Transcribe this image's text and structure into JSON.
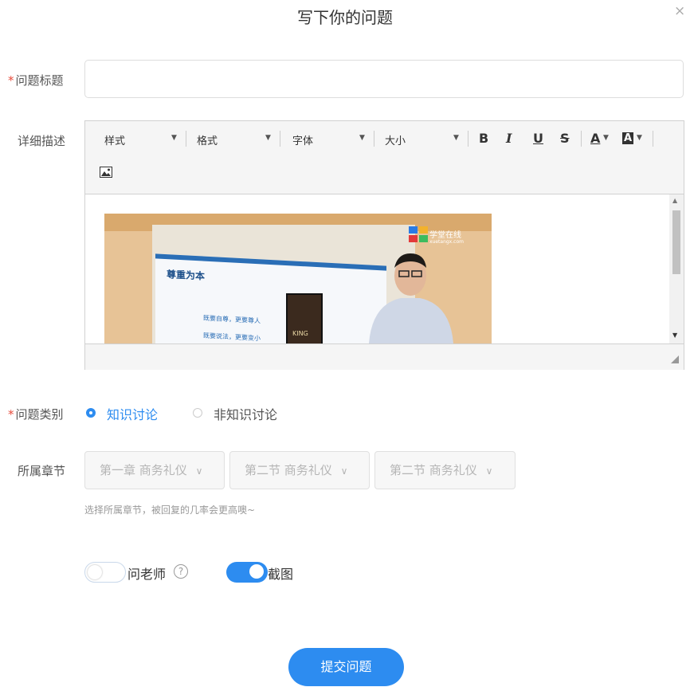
{
  "dialog": {
    "title": "写下你的问题",
    "close_symbol": "×"
  },
  "question_title": {
    "label": "问题标题",
    "required_mark": "*",
    "value": ""
  },
  "description": {
    "label": "详细描述",
    "toolbar": {
      "style_label": "样式",
      "format_label": "格式",
      "font_label": "字体",
      "size_label": "大小",
      "bold": "B",
      "italic": "I",
      "underline": "U",
      "strike": "S",
      "font_color": "A",
      "bg_color": "A"
    },
    "image": {
      "brand": "学堂在线",
      "brand_sub": "xuetangx.com",
      "slide_title": "尊重为本",
      "slide_line1": "既要自尊，更要尊人",
      "slide_line2": "既要说法，更要变小",
      "book_title": "KING"
    }
  },
  "category": {
    "label": "问题类别",
    "required_mark": "*",
    "options": [
      {
        "label": "知识讨论",
        "selected": true
      },
      {
        "label": "非知识讨论",
        "selected": false
      }
    ]
  },
  "chapter": {
    "label": "所属章节",
    "selects": [
      "第一章 商务礼仪",
      "第二节 商务礼仪",
      "第二节 商务礼仪"
    ],
    "hint": "选择所属章节，被回复的几率会更高噢~"
  },
  "toggles": {
    "ask_teacher": {
      "label": "问老师",
      "on": false,
      "help": "?"
    },
    "screenshot": {
      "label": "截图",
      "on": true
    }
  },
  "submit_label": "提交问题",
  "colors": {
    "accent": "#2d8cf0",
    "required": "#e74c3c",
    "hint": "#999999"
  }
}
